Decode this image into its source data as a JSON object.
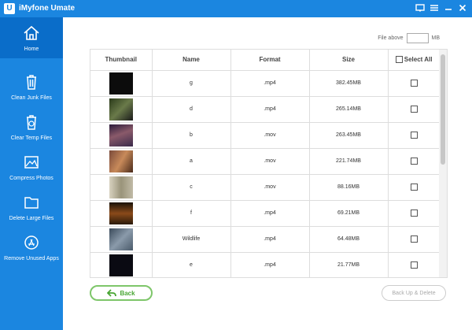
{
  "window": {
    "title": "iMyfone Umate",
    "logo_letter": "U"
  },
  "sidebar": {
    "items": [
      {
        "label": "Home",
        "icon": "home-icon",
        "active": true
      },
      {
        "label": "Clean Junk Files",
        "icon": "trash-icon"
      },
      {
        "label": "Clear Temp Files",
        "icon": "temp-trash-icon"
      },
      {
        "label": "Compress Photos",
        "icon": "photo-icon"
      },
      {
        "label": "Delete Large Files",
        "icon": "folder-icon"
      },
      {
        "label": "Remove Unused Apps",
        "icon": "app-store-icon"
      }
    ]
  },
  "filter": {
    "label": "File above",
    "value": "",
    "unit": "MB"
  },
  "table": {
    "headers": {
      "thumbnail": "Thumbnail",
      "name": "Name",
      "format": "Format",
      "size": "Size",
      "select_all": "Select All"
    },
    "rows": [
      {
        "name": "g",
        "format": ".mp4",
        "size": "382.45MB",
        "thumb_color": "#0c0c0c"
      },
      {
        "name": "d",
        "format": ".mp4",
        "size": "265.14MB",
        "thumb_color": "#3a4a2a"
      },
      {
        "name": "b",
        "format": ".mov",
        "size": "263.45MB",
        "thumb_color": "#4a3a5a"
      },
      {
        "name": "a",
        "format": ".mov",
        "size": "221.74MB",
        "thumb_color": "#6a4a3a"
      },
      {
        "name": "c",
        "format": ".mov",
        "size": "88.16MB",
        "thumb_color": "#b6b09a"
      },
      {
        "name": "f",
        "format": ".mp4",
        "size": "69.21MB",
        "thumb_color": "#3a2a1a"
      },
      {
        "name": "Wildlife",
        "format": ".mp4",
        "size": "64.48MB",
        "thumb_color": "#5a6a7a"
      },
      {
        "name": "e",
        "format": ".mp4",
        "size": "21.77MB",
        "thumb_color": "#0a0a12"
      }
    ]
  },
  "buttons": {
    "back": "Back",
    "backup_delete": "Back Up & Delete"
  },
  "colors": {
    "brand": "#1b86e0",
    "active_sidebar": "#0a6dc9",
    "back_green": "#49a634"
  }
}
